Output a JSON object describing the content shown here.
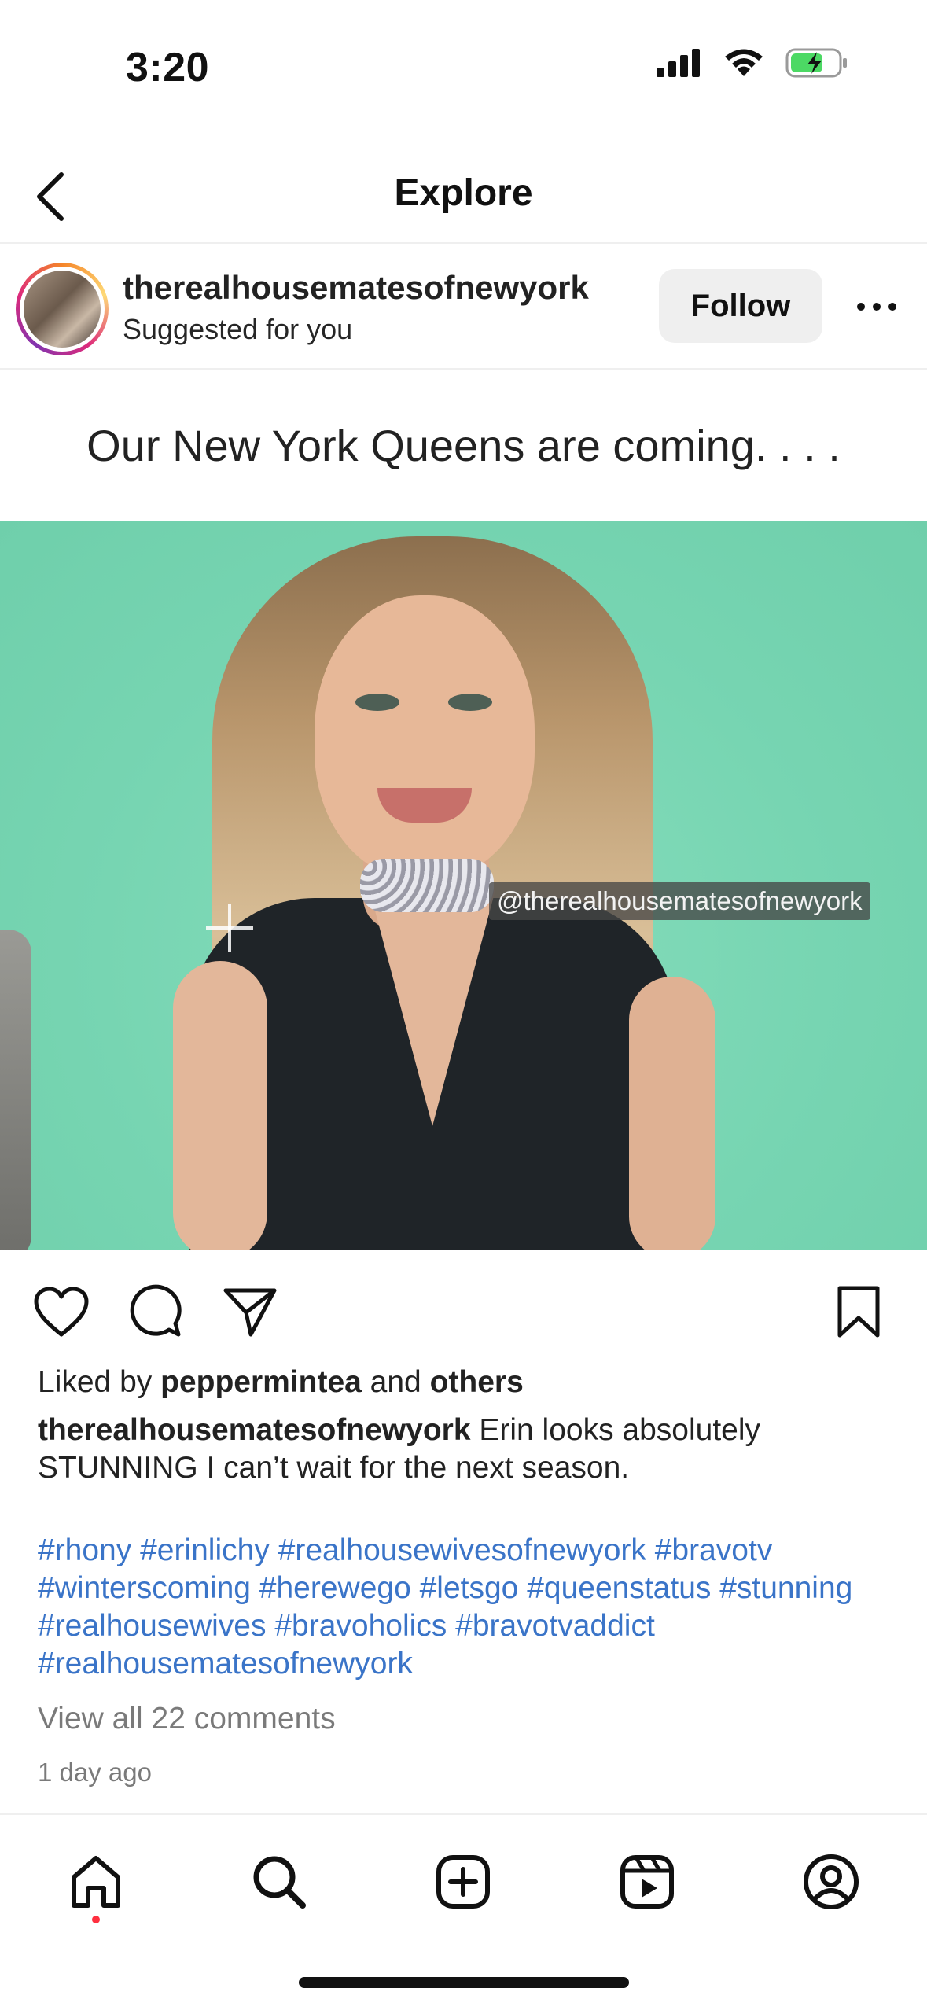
{
  "status_bar": {
    "time": "3:20",
    "icons": [
      "signal-icon",
      "wifi-icon",
      "battery-charging-icon"
    ]
  },
  "nav": {
    "title": "Explore",
    "back_icon": "chevron-left-icon"
  },
  "post": {
    "username": "therealhousematesofnewyork",
    "subtitle": "Suggested for you",
    "follow_label": "Follow",
    "banner_text": "Our New York Queens are coming. . . .",
    "media": {
      "watermark": "@therealhousematesofnewyork",
      "background_color": "#77d5b2"
    },
    "actions": [
      "heart-icon",
      "comment-icon",
      "share-icon",
      "bookmark-icon"
    ],
    "likes": {
      "prefix": "Liked by ",
      "user": "peppermintea",
      "middle": " and ",
      "others": "others"
    },
    "caption": {
      "user": "therealhousematesofnewyork",
      "text": " Erin looks absolutely STUNNING I can’t wait for the next season."
    },
    "hashtags": "#rhony #erinlichy #realhousewivesofnewyork #bravotv #winterscoming #herewego #letsgo #queenstatus #stunning #realhousewives #bravoholics #bravotvaddict #realhousematesofnewyork",
    "comments_link": "View all 22 comments",
    "time_ago": "1 day ago"
  },
  "tab_bar": {
    "tabs": [
      "home-icon",
      "search-icon",
      "create-icon",
      "reels-icon",
      "profile-icon"
    ],
    "active": "home-icon"
  },
  "colors": {
    "link_blue": "#3a74c8",
    "muted_gray": "#7a7a7a",
    "notification_red": "#ff3040"
  }
}
